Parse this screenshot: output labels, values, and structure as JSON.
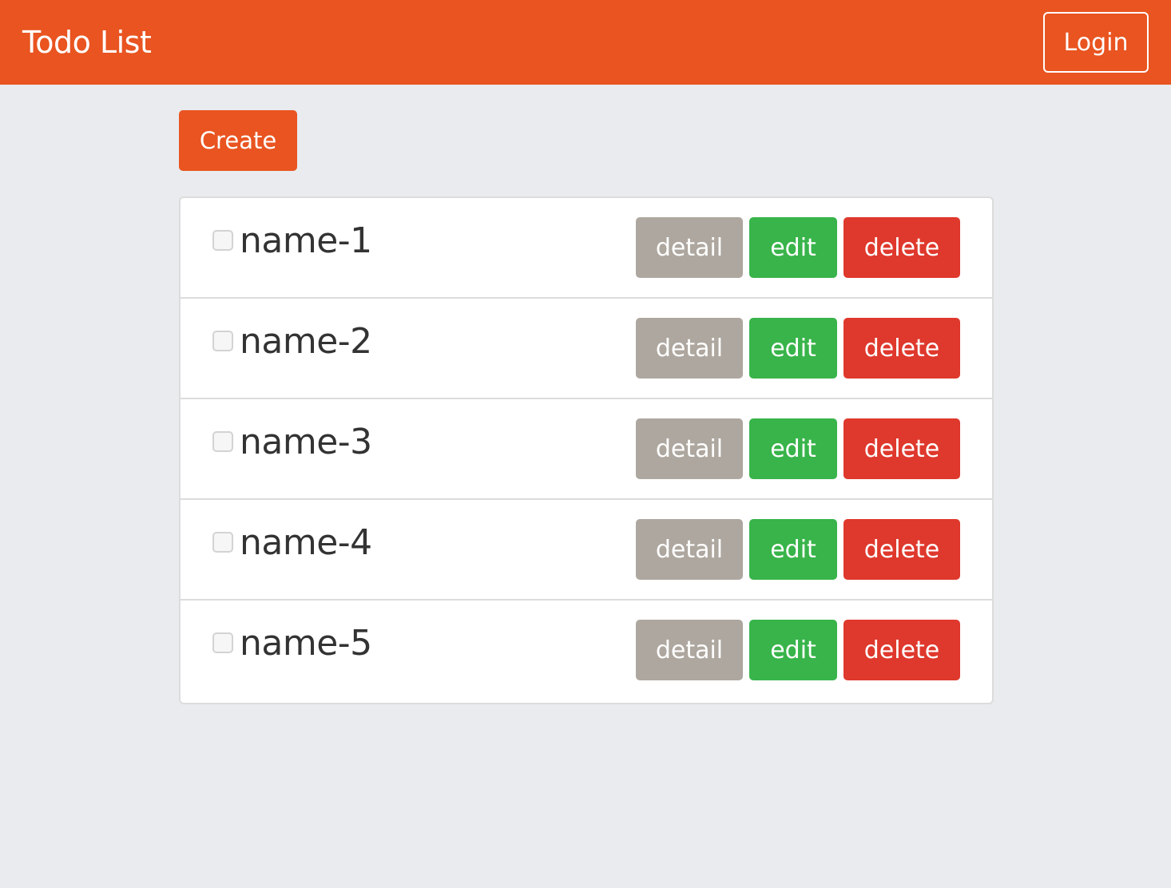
{
  "navbar": {
    "brand": "Todo List",
    "login_label": "Login"
  },
  "toolbar": {
    "create_label": "Create"
  },
  "todos": [
    {
      "name": "name-1",
      "checked": false
    },
    {
      "name": "name-2",
      "checked": false
    },
    {
      "name": "name-3",
      "checked": false
    },
    {
      "name": "name-4",
      "checked": false
    },
    {
      "name": "name-5",
      "checked": false
    }
  ],
  "row_actions": {
    "detail_label": "detail",
    "edit_label": "edit",
    "delete_label": "delete"
  },
  "icons": {
    "checkbox": "checkbox-icon"
  },
  "colors": {
    "primary": "#e95420",
    "background": "#e9ebee",
    "detail": "#aea79f",
    "edit": "#38b44a",
    "delete": "#df382c"
  }
}
